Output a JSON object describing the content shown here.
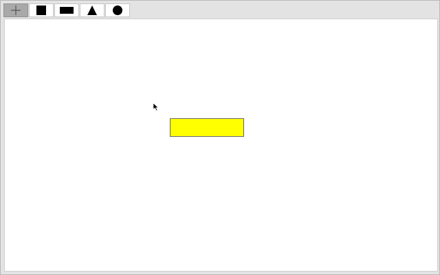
{
  "toolbar": {
    "tools": [
      {
        "name": "select",
        "icon": "crosshair-icon",
        "active": true
      },
      {
        "name": "square",
        "icon": "square-icon",
        "active": false
      },
      {
        "name": "rectangle",
        "icon": "rectangle-icon",
        "active": false
      },
      {
        "name": "triangle",
        "icon": "triangle-icon",
        "active": false
      },
      {
        "name": "circle",
        "icon": "circle-icon",
        "active": false
      }
    ]
  },
  "canvas": {
    "shapes": [
      {
        "type": "rectangle",
        "fill": "#ffff00",
        "stroke": "#666666"
      }
    ]
  },
  "colors": {
    "active_tool": "#a9a9a9",
    "canvas_bg": "#ffffff",
    "shape_fill": "#ffff00"
  }
}
